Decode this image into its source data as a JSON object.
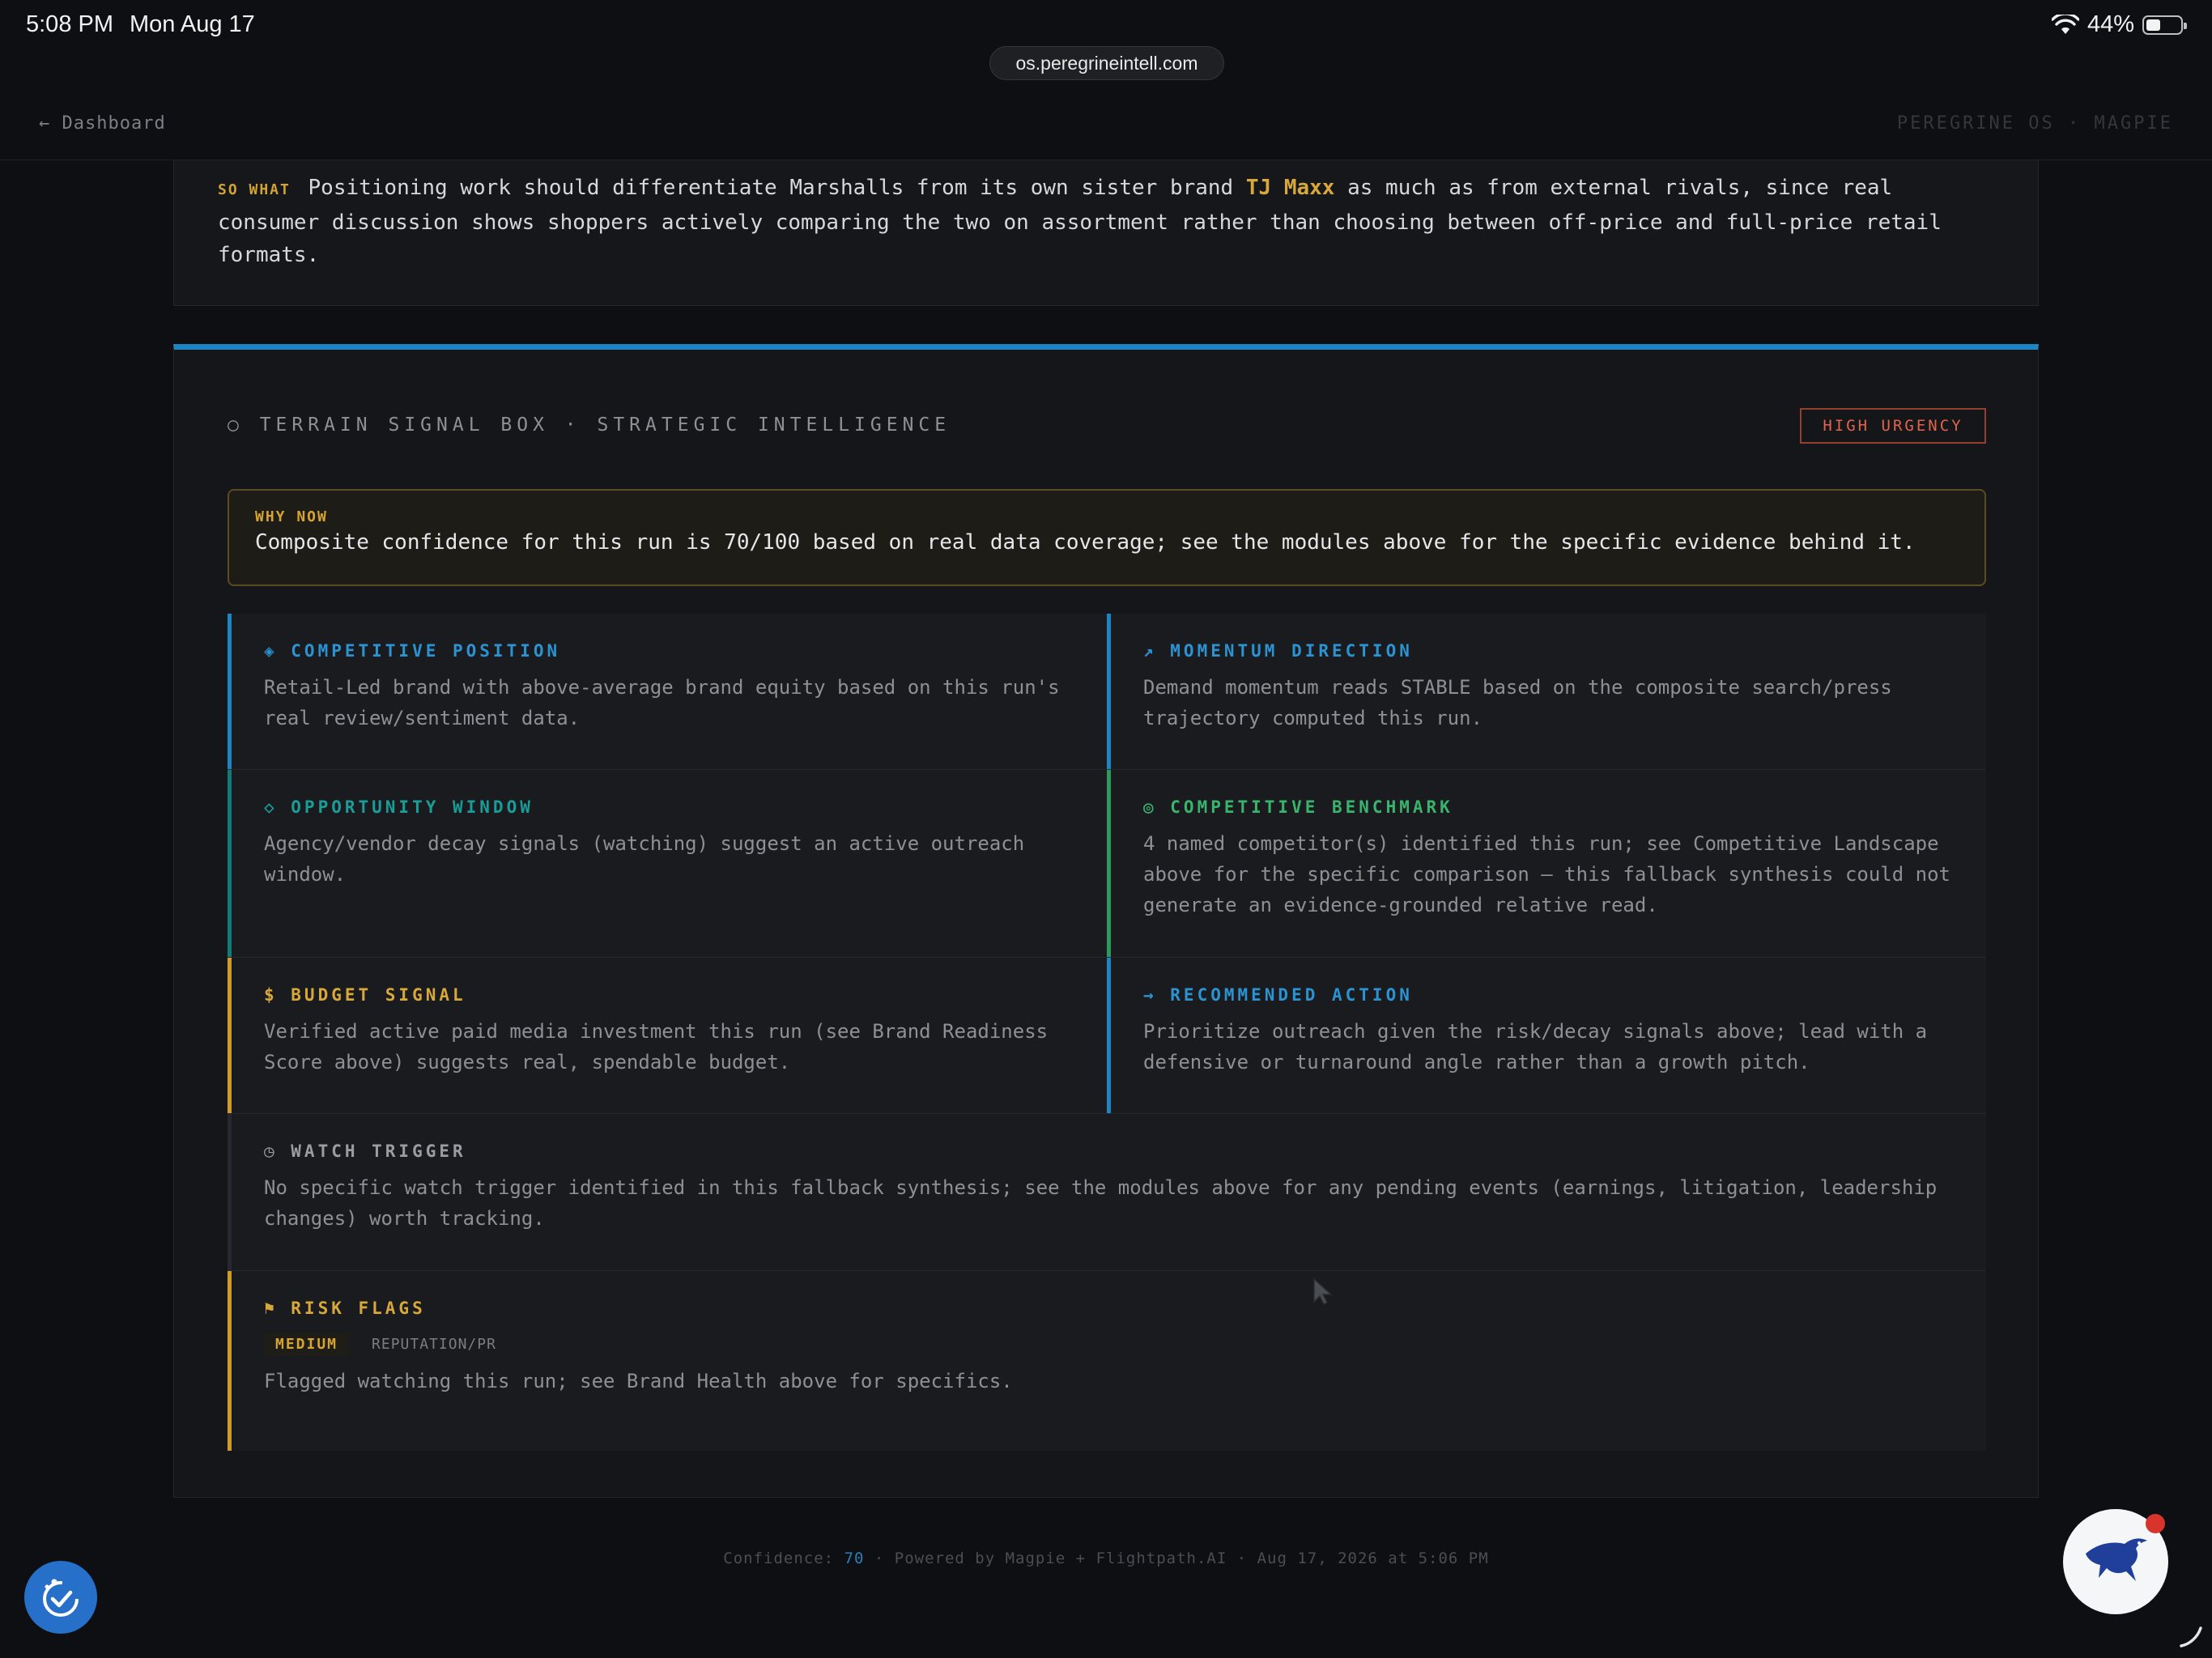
{
  "status_bar": {
    "time": "5:08 PM",
    "date": "Mon Aug 17",
    "battery": "44%",
    "battery_level": 0.44
  },
  "browser": {
    "url": "os.peregrineintell.com"
  },
  "nav": {
    "back_label": "← Dashboard",
    "brand": "PEREGRINE OS · MAGPIE"
  },
  "so_what": {
    "tag": "SO WHAT",
    "text_before": " Positioning work should differentiate Marshalls from its own sister brand ",
    "brand": "TJ Maxx",
    "text_after": " as much as from external rivals, since real consumer discussion shows shoppers actively comparing the two on assortment rather than choosing between off-price and full-price retail formats."
  },
  "terrain": {
    "heading": "○ TERRAIN SIGNAL BOX · STRATEGIC INTELLIGENCE",
    "urgency": "HIGH URGENCY",
    "why_now": {
      "label": "WHY NOW",
      "text": "Composite confidence for this run is 70/100 based on real data coverage; see the modules above for the specific evidence behind it."
    },
    "cells": {
      "competitive_position": {
        "title": "◈ COMPETITIVE POSITION",
        "body": "Retail-Led brand with above-average brand equity based on this run's real review/sentiment data."
      },
      "momentum_direction": {
        "title": "↗ MOMENTUM DIRECTION",
        "body": "Demand momentum reads STABLE based on the composite search/press trajectory computed this run."
      },
      "opportunity_window": {
        "title": "◇ OPPORTUNITY WINDOW",
        "body": "Agency/vendor decay signals (watching) suggest an active outreach window."
      },
      "competitive_benchmark": {
        "title": "◎ COMPETITIVE BENCHMARK",
        "body": "4 named competitor(s) identified this run; see Competitive Landscape above for the specific comparison — this fallback synthesis could not generate an evidence-grounded relative read."
      },
      "budget_signal": {
        "title": "$ BUDGET SIGNAL",
        "body": "Verified active paid media investment this run (see Brand Readiness Score above) suggests real, spendable budget."
      },
      "recommended_action": {
        "title": "→ RECOMMENDED ACTION",
        "body": "Prioritize outreach given the risk/decay signals above; lead with a defensive or turnaround angle rather than a growth pitch."
      },
      "watch_trigger": {
        "title": "◷ WATCH TRIGGER",
        "body": "No specific watch trigger identified in this fallback synthesis; see the modules above for any pending events (earnings, litigation, leadership changes) worth tracking."
      },
      "risk_flags": {
        "title": "⚑ RISK FLAGS",
        "level": "MEDIUM",
        "category": "REPUTATION/PR",
        "body": "Flagged watching this run; see Brand Health above for specifics."
      }
    }
  },
  "footer": {
    "prefix": "Confidence: ",
    "confidence": "70",
    "suffix": " · Powered by Magpie + Flightpath.AI · Aug 17, 2026 at 5:06 PM"
  },
  "colors": {
    "accent_blue": "#1e84c2",
    "urgency_red": "#e0654a",
    "gold": "#d8a83a",
    "green": "#39b46c",
    "teal": "#1a9c98"
  }
}
